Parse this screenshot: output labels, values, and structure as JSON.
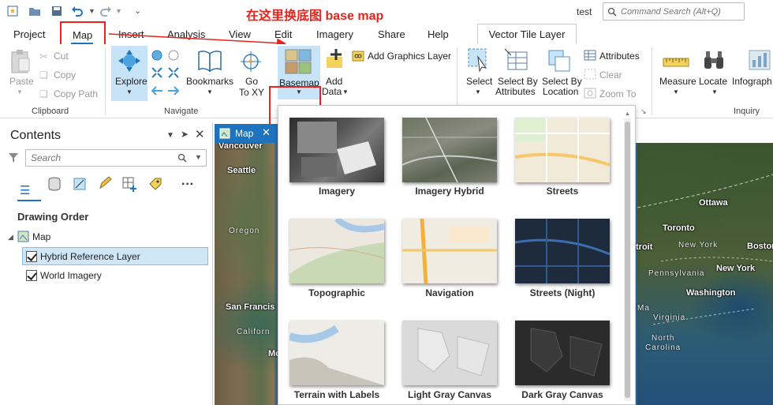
{
  "titlebar": {
    "annotation": "在这里换底图 base map",
    "user": "test",
    "command_search_placeholder": "Command Search (Alt+Q)"
  },
  "tabs": [
    "Project",
    "Map",
    "Insert",
    "Analysis",
    "View",
    "Edit",
    "Imagery",
    "Share",
    "Help"
  ],
  "contextual_tab": "Vector Tile Layer",
  "ribbon": {
    "clipboard": {
      "group": "Clipboard",
      "paste": "Paste",
      "cut": "Cut",
      "copy": "Copy",
      "copy_path": "Copy Path"
    },
    "navigate": {
      "group": "Navigate",
      "explore": "Explore",
      "bookmarks": "Bookmarks",
      "goto_line1": "Go",
      "goto_line2": "To XY"
    },
    "layer": {
      "basemap": "Basemap",
      "add_data_line1": "Add",
      "add_data_line2": "Data",
      "add_graphics": "Add Graphics Layer"
    },
    "selection": {
      "select": "Select",
      "select_by_attr_1": "Select By",
      "select_by_attr_2": "Attributes",
      "select_by_loc_1": "Select By",
      "select_by_loc_2": "Location",
      "attributes": "Attributes",
      "clear": "Clear",
      "zoom_to": "Zoom To"
    },
    "inquiry": {
      "group": "Inquiry",
      "measure": "Measure",
      "locate": "Locate",
      "infographics": "Infograph"
    }
  },
  "contents": {
    "title": "Contents",
    "search_placeholder": "Search",
    "drawing_order": "Drawing Order",
    "map_name": "Map",
    "layers": [
      {
        "name": "Hybrid Reference Layer",
        "checked": true,
        "selected": true
      },
      {
        "name": "World Imagery",
        "checked": true,
        "selected": false
      }
    ]
  },
  "map_tab": "Map",
  "map_labels": {
    "cities": [
      "Vancouver",
      "Seattle",
      "San Francis",
      "Ottawa",
      "Toronto",
      "New York",
      "Boston",
      "troit",
      "Washington",
      "Mo"
    ],
    "regions": [
      "Oregon",
      "Californ",
      "New York",
      "Pennsylvania",
      "Virginia",
      "North",
      "Carolina",
      "Ma"
    ]
  },
  "basemaps": [
    {
      "name": "Imagery"
    },
    {
      "name": "Imagery Hybrid"
    },
    {
      "name": "Streets"
    },
    {
      "name": "Topographic"
    },
    {
      "name": "Navigation"
    },
    {
      "name": "Streets (Night)"
    },
    {
      "name": "Terrain with Labels"
    },
    {
      "name": "Light Gray Canvas"
    },
    {
      "name": "Dark Gray Canvas"
    }
  ],
  "colors": {
    "accent": "#1e73be",
    "annotation": "#e8231b",
    "highlight": "#c7e3f7"
  }
}
